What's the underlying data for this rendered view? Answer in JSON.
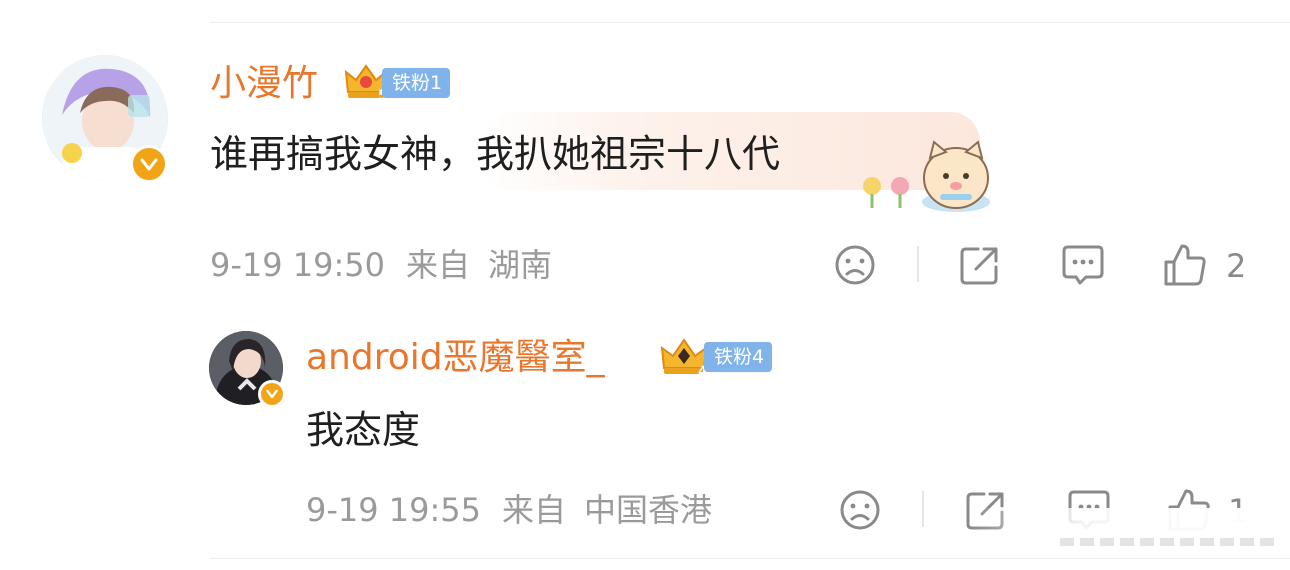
{
  "comments": [
    {
      "user": "小漫竹",
      "fan_level": "铁粉1",
      "crown_number": "5",
      "text": "谁再搞我女神，我扒她祖宗十八代",
      "time": "9-19 19:50",
      "from_label": "来自",
      "location": "湖南",
      "likes": "2"
    }
  ],
  "replies": [
    {
      "user": "android恶魔醫室_",
      "fan_level": "铁粉4",
      "crown_number": "4",
      "text": "我态度",
      "time": "9-19 19:55",
      "from_label": "来自",
      "location": "中国香港",
      "likes": "1"
    }
  ],
  "icons": {
    "dislike": "frown-face-icon",
    "share": "share-icon",
    "comment": "comment-bubble-icon",
    "like": "thumbs-up-icon"
  },
  "colors": {
    "username": "#e8772e",
    "fan_badge": "#7fb3ea",
    "verified_badge": "#f2a417",
    "meta_text": "#9a9a9a"
  }
}
